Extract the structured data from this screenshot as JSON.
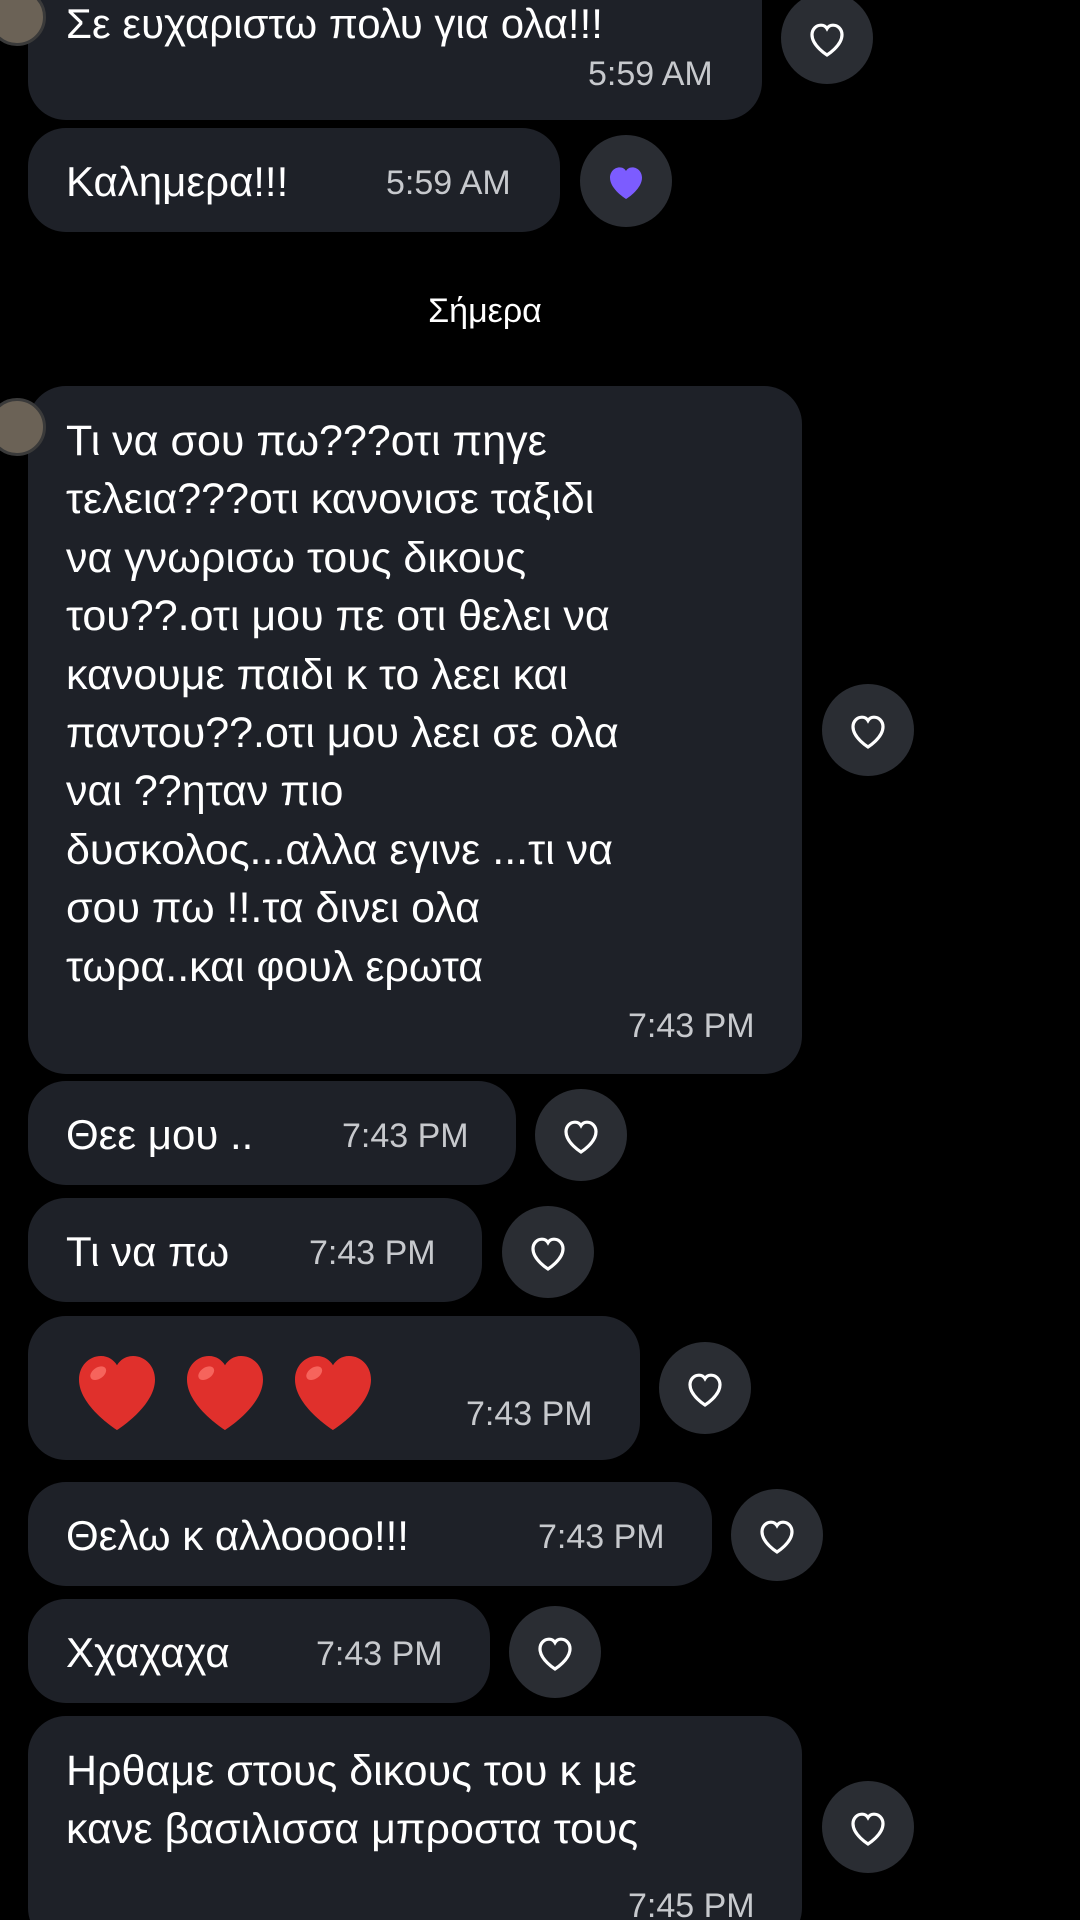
{
  "date_separator": "Σήμερα",
  "messages": [
    {
      "text": "Σε ευχαριστω πολυ για ολα!!!",
      "time": "5:59 AM",
      "liked": false
    },
    {
      "text": "Καλημερα!!!",
      "time": "5:59 AM",
      "liked": true
    },
    {
      "text": "Τι να σου πω???οτι πηγε\nτελεια???οτι κανονισε ταξιδι\nνα γνωρισω τους δικους\nτου??.οτι μου πε οτι θελει να\nκανουμε παιδι κ το λεει και\nπαντου??.οτι μου λεει σε ολα\nναι ??ηταν πιο\nδυσκολος...αλλα εγινε ...τι να\nσου πω !!.τα δινει ολα\nτωρα..και φουλ ερωτα",
      "time": "7:43 PM",
      "liked": false
    },
    {
      "text": "Θεε μου ..",
      "time": "7:43 PM",
      "liked": false
    },
    {
      "text": "Τι να πω",
      "time": "7:43 PM",
      "liked": false
    },
    {
      "text": "❤️❤️❤️",
      "time": "7:43 PM",
      "liked": false
    },
    {
      "text": "Θελω κ αλλοooo!!!",
      "time": "7:43 PM",
      "liked": false
    },
    {
      "text": "Χχαχαχα",
      "time": "7:43 PM",
      "liked": false
    },
    {
      "text": "Ηρθαμε στους δικους του κ με\nκανε βασιλισσα μπροστα τους",
      "time": "7:45 PM",
      "liked": false
    }
  ],
  "colors": {
    "background": "#000000",
    "bubble": "#1e2128",
    "react_button": "#2a2d33",
    "liked_heart": "#7c5cff",
    "emoji_heart": "#e0302c"
  },
  "icons": {
    "like": "heart-outline-icon",
    "liked": "heart-filled-icon"
  }
}
